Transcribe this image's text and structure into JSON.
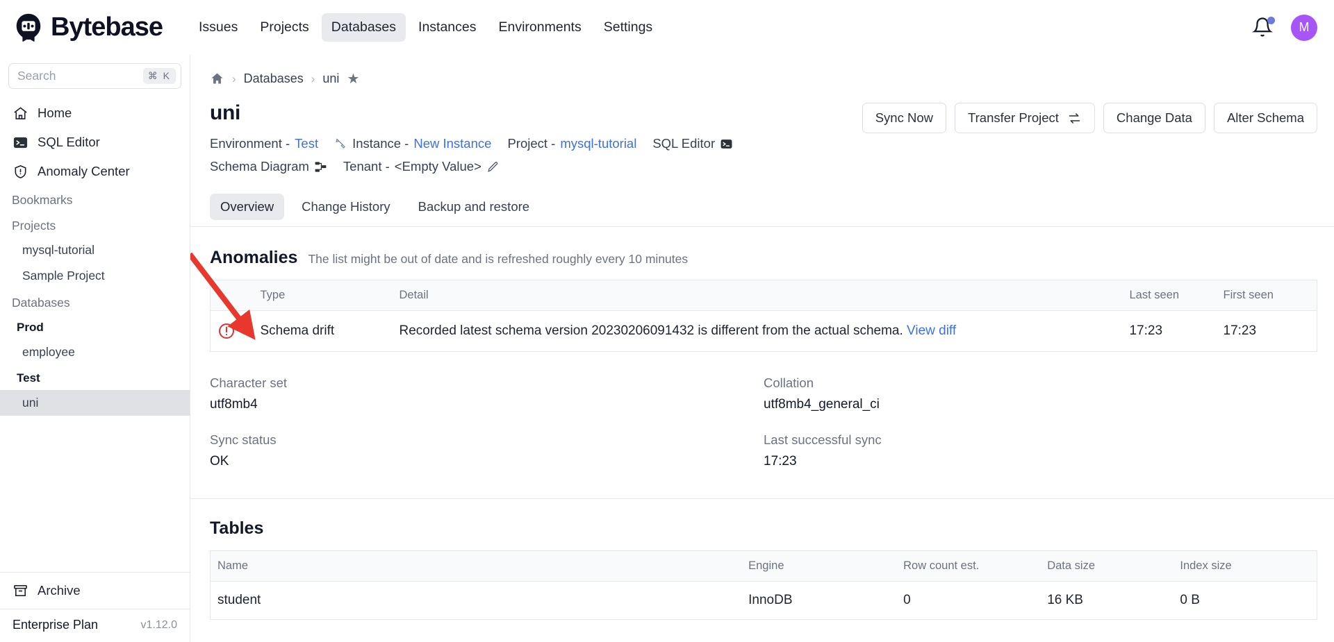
{
  "brand": {
    "name": "Bytebase",
    "logo_icon": "bytebase-logo-icon"
  },
  "topnav": {
    "items": [
      {
        "label": "Issues",
        "active": false
      },
      {
        "label": "Projects",
        "active": false
      },
      {
        "label": "Databases",
        "active": true
      },
      {
        "label": "Instances",
        "active": false
      },
      {
        "label": "Environments",
        "active": false
      },
      {
        "label": "Settings",
        "active": false
      }
    ],
    "notification_icon": "bell-icon",
    "avatar_initial": "M",
    "avatar_color": "#a855f7",
    "notification_dot_color": "#6c7ae0"
  },
  "sidebar": {
    "search": {
      "placeholder": "Search",
      "shortcut": "⌘ K"
    },
    "items": [
      {
        "label": "Home",
        "icon": "home-icon"
      },
      {
        "label": "SQL Editor",
        "icon": "terminal-icon"
      },
      {
        "label": "Anomaly Center",
        "icon": "shield-alert-icon"
      }
    ],
    "bookmarks_label": "Bookmarks",
    "projects_label": "Projects",
    "projects": [
      {
        "label": "mysql-tutorial"
      },
      {
        "label": "Sample Project"
      }
    ],
    "databases_label": "Databases",
    "database_groups": [
      {
        "group": "Prod",
        "databases": [
          {
            "label": "employee",
            "selected": false
          }
        ]
      },
      {
        "group": "Test",
        "databases": [
          {
            "label": "uni",
            "selected": true
          }
        ]
      }
    ],
    "archive": {
      "label": "Archive",
      "icon": "archive-icon"
    },
    "plan": {
      "name": "Enterprise Plan",
      "version": "v1.12.0"
    }
  },
  "breadcrumb": {
    "home_icon": "home-icon",
    "items": [
      {
        "label": "Databases",
        "link": true
      },
      {
        "label": "uni",
        "link": false
      }
    ],
    "star_icon": "star-icon"
  },
  "database": {
    "name": "uni",
    "meta": {
      "environment_label": "Environment -",
      "environment_value": "Test",
      "instance_icon": "instance-icon",
      "instance_label": "Instance -",
      "instance_value": "New Instance",
      "project_label": "Project -",
      "project_value": "mysql-tutorial",
      "sql_editor_label": "SQL Editor",
      "sql_editor_icon": "terminal-icon",
      "schema_diagram_label": "Schema Diagram",
      "schema_diagram_icon": "diagram-icon",
      "tenant_label": "Tenant -",
      "tenant_value": "<Empty Value>",
      "tenant_edit_icon": "pencil-icon"
    }
  },
  "actions": [
    {
      "label": "Sync Now",
      "icon": null
    },
    {
      "label": "Transfer Project",
      "icon": "transfer-icon"
    },
    {
      "label": "Change Data",
      "icon": null
    },
    {
      "label": "Alter Schema",
      "icon": null
    }
  ],
  "tabs": [
    {
      "label": "Overview",
      "active": true
    },
    {
      "label": "Change History",
      "active": false
    },
    {
      "label": "Backup and restore",
      "active": false
    }
  ],
  "anomalies": {
    "title": "Anomalies",
    "note": "The list might be out of date and is refreshed roughly every 10 minutes",
    "columns": [
      "",
      "Type",
      "Detail",
      "Last seen",
      "First seen"
    ],
    "rows": [
      {
        "icon": "error-circle-icon",
        "icon_color": "#d93535",
        "type": "Schema drift",
        "detail": "Recorded latest schema version 20230206091432 is different from the actual schema.",
        "detail_link": "View diff",
        "last_seen": "17:23",
        "first_seen": "17:23"
      }
    ]
  },
  "details": {
    "character_set_label": "Character set",
    "character_set_value": "utf8mb4",
    "collation_label": "Collation",
    "collation_value": "utf8mb4_general_ci",
    "sync_status_label": "Sync status",
    "sync_status_value": "OK",
    "last_sync_label": "Last successful sync",
    "last_sync_value": "17:23"
  },
  "tables": {
    "title": "Tables",
    "columns": [
      "Name",
      "Engine",
      "Row count est.",
      "Data size",
      "Index size"
    ],
    "rows": [
      {
        "name": "student",
        "engine": "InnoDB",
        "row_count": "0",
        "data_size": "16 KB",
        "index_size": "0 B"
      }
    ]
  },
  "annotation": {
    "arrow_color": "#e8382e"
  }
}
